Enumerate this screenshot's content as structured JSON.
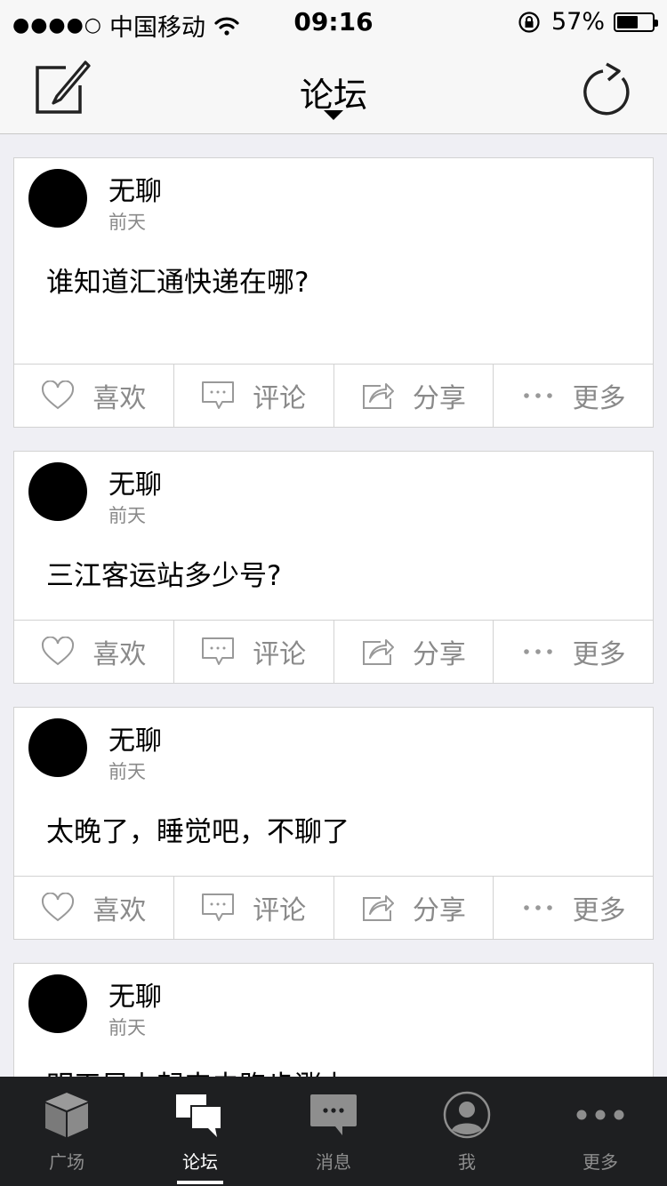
{
  "status_bar": {
    "signal": "●●●●○",
    "carrier": "中国移动",
    "time": "09:16",
    "battery": "57%"
  },
  "nav": {
    "title": "论坛",
    "compose_icon": "compose-icon",
    "refresh_icon": "refresh-icon"
  },
  "actions": {
    "like": "喜欢",
    "comment": "评论",
    "share": "分享",
    "more": "更多"
  },
  "posts": [
    {
      "author": "无聊",
      "time": "前天",
      "content": "谁知道汇通快递在哪?"
    },
    {
      "author": "无聊",
      "time": "前天",
      "content": "三江客运站多少号?"
    },
    {
      "author": "无聊",
      "time": "前天",
      "content": "太晚了，睡觉吧，不聊了"
    },
    {
      "author": "无聊",
      "time": "前天",
      "content": "明天早上起来去跑步涨力"
    }
  ],
  "tabbar": {
    "items": [
      {
        "label": "广场",
        "icon": "cube-icon",
        "active": false
      },
      {
        "label": "论坛",
        "icon": "chat-bubbles-icon",
        "active": true
      },
      {
        "label": "消息",
        "icon": "message-icon",
        "active": false
      },
      {
        "label": "我",
        "icon": "user-icon",
        "active": false
      },
      {
        "label": "更多",
        "icon": "more-icon",
        "active": false
      }
    ]
  },
  "colors": {
    "background": "#efeff4",
    "tabbar": "#1e1f21",
    "muted_text": "#8a8a8a"
  }
}
